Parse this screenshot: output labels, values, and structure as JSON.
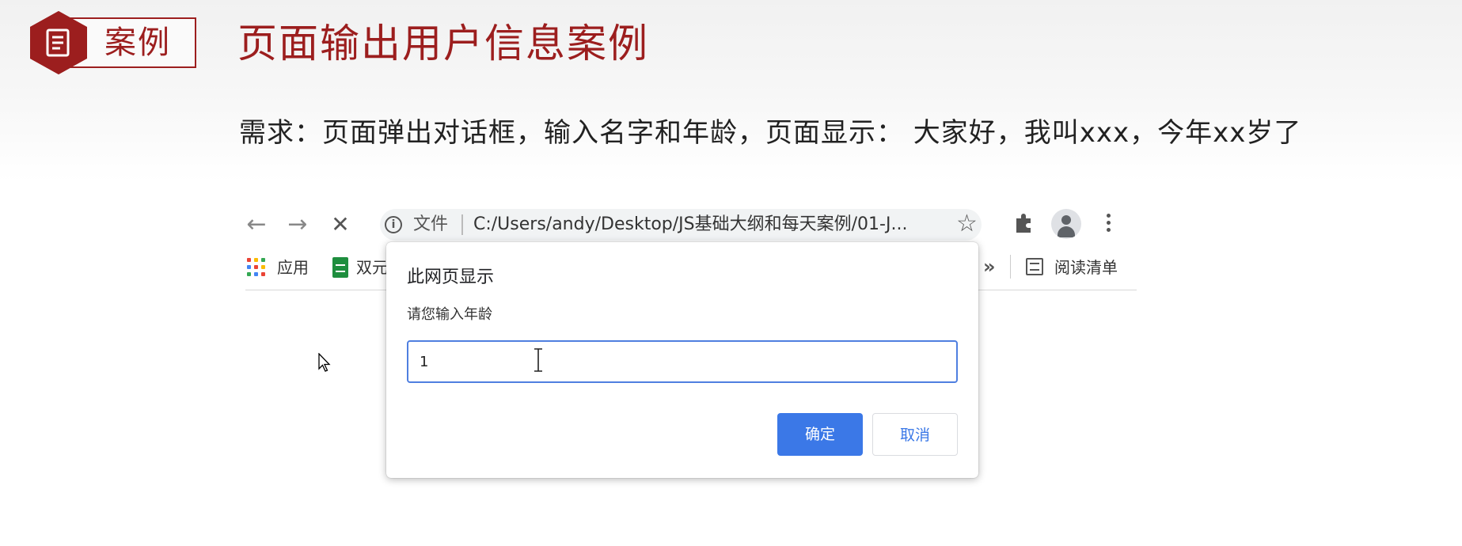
{
  "slide": {
    "tag": "案例",
    "title": "页面输出用户信息案例",
    "requirement": "需求：页面弹出对话框，输入名字和年龄，页面显示： 大家好，我叫xxx，今年xx岁了"
  },
  "browser": {
    "nav": {
      "back": "←",
      "forward": "→",
      "stop": "✕"
    },
    "address": {
      "scheme_label": "文件",
      "url": "C:/Users/andy/Desktop/JS基础大纲和每天案例/01-J..."
    },
    "bookmarks": [
      {
        "label": "应用",
        "icon": "apps-grid-icon"
      },
      {
        "label": "双元",
        "icon": "sheets-icon"
      }
    ],
    "bookmarks_overflow": "»",
    "reading_list": {
      "label": "阅读清单",
      "icon": "reading-list-icon"
    }
  },
  "dialog": {
    "title": "此网页显示",
    "message": "请您输入年龄",
    "input_value": "1",
    "ok_label": "确定",
    "cancel_label": "取消"
  },
  "colors": {
    "brand_red": "#9c1e1e",
    "dialog_button_blue": "#3b78e7",
    "input_focus_border": "#4f7fe0"
  }
}
